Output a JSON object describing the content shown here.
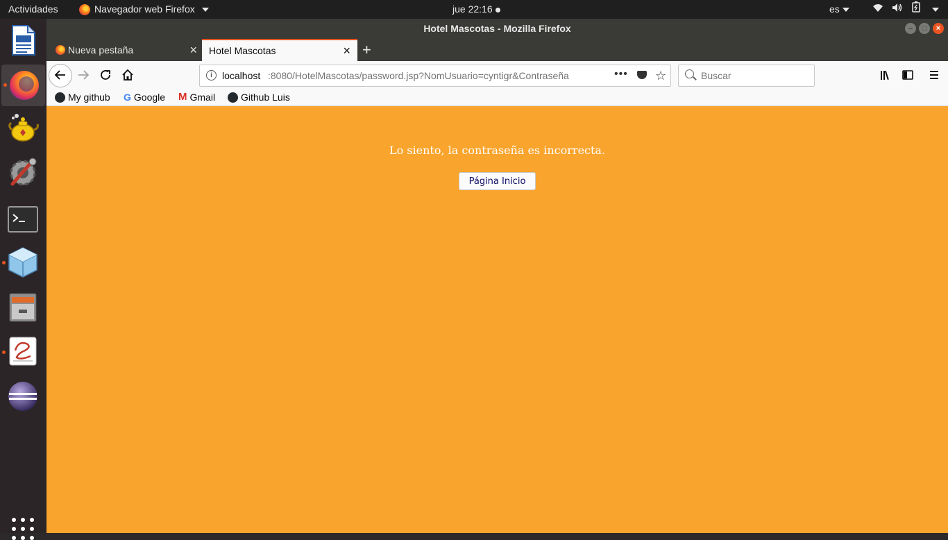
{
  "topbar": {
    "activities": "Actividades",
    "app_menu": "Navegador web Firefox",
    "clock": "jue 22:16",
    "language": "es"
  },
  "dock": {
    "items": [
      "libreoffice-writer-icon",
      "firefox-icon",
      "teapot-icon",
      "settings-tools-icon",
      "terminal-icon",
      "virtualbox-icon",
      "file-cabinet-icon",
      "document-viewer-icon",
      "eclipse-icon",
      "show-apps-icon"
    ]
  },
  "window": {
    "title": "Hotel Mascotas - Mozilla Firefox"
  },
  "tabs": [
    {
      "label": "Nueva pestaña"
    },
    {
      "label": "Hotel Mascotas"
    }
  ],
  "navbar": {
    "url_host": "localhost",
    "url_path": ":8080/HotelMascotas/password.jsp?NomUsuario=cyntigr&Contraseña",
    "search_placeholder": "Buscar"
  },
  "bookmarks": [
    {
      "label": "My github"
    },
    {
      "label": "Google"
    },
    {
      "label": "Gmail"
    },
    {
      "label": "Github Luis"
    }
  ],
  "page": {
    "message": "Lo siento, la contraseña es incorrecta.",
    "button_label": "Página Inicio"
  },
  "colors": {
    "page_background": "#f9a42c",
    "accent": "#e95420"
  }
}
